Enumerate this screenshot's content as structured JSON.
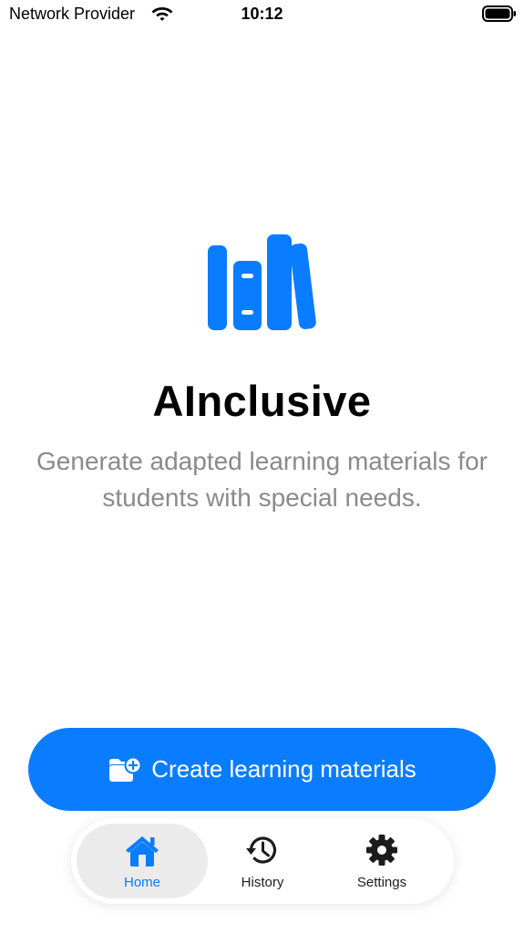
{
  "status_bar": {
    "carrier": "Network Provider",
    "time": "10:12",
    "wifi_icon": "wifi-icon",
    "battery_icon": "battery-full-icon"
  },
  "hero": {
    "logo_icon": "books-on-shelf-icon",
    "title": "AInclusive",
    "subtitle": "Generate adapted learning materials for students with special needs."
  },
  "cta": {
    "icon": "folder-badge-plus-icon",
    "label": "Create learning materials"
  },
  "tab_bar": {
    "selected": "Home",
    "tabs": [
      {
        "label": "Home",
        "icon": "house-icon",
        "active": true
      },
      {
        "label": "History",
        "icon": "clock-arrow-circlepath-icon",
        "active": false
      },
      {
        "label": "Settings",
        "icon": "gear-icon",
        "active": false
      }
    ]
  },
  "colors": {
    "accent": "#0a7cff",
    "subtitle_gray": "#8a8a8e",
    "tab_selected_bg": "#ebebeb"
  }
}
